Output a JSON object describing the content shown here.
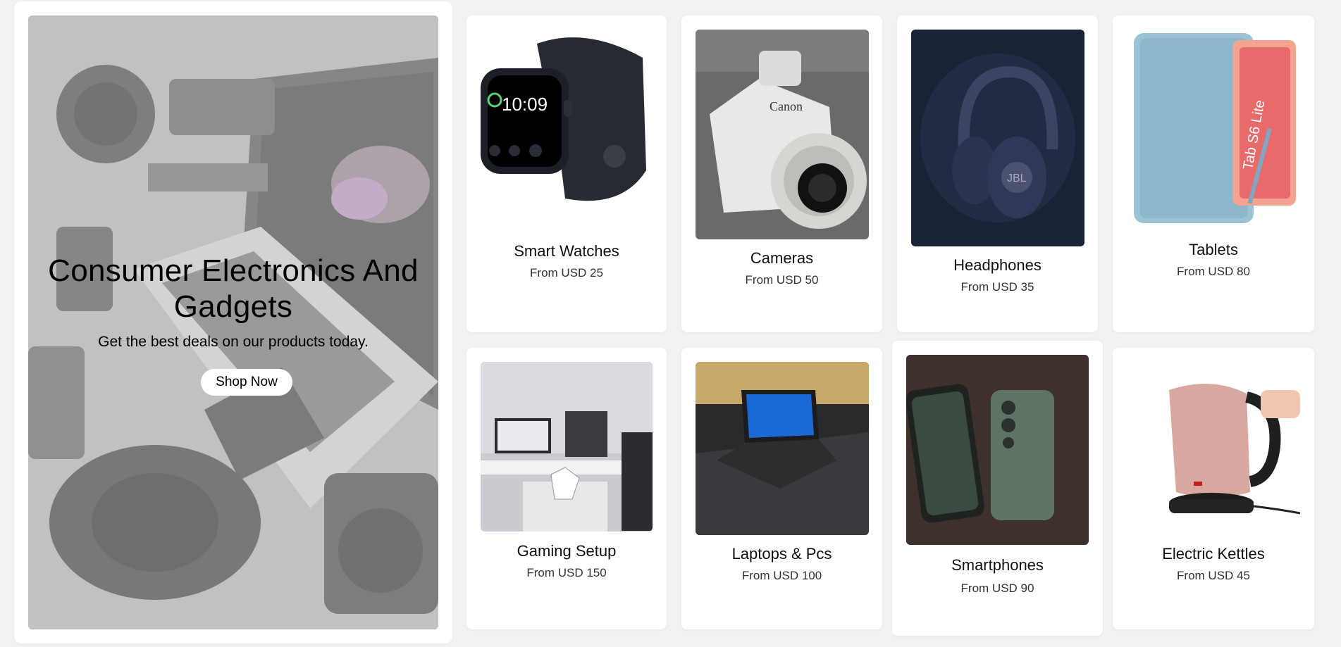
{
  "hero": {
    "title": "Consumer Electronics And Gadgets",
    "subtitle": "Get the best deals on our products today.",
    "button_label": "Shop Now"
  },
  "products": [
    {
      "name": "Smart Watches",
      "price": "From USD 25",
      "icon": "smartwatch-image"
    },
    {
      "name": "Cameras",
      "price": "From USD 50",
      "icon": "camera-image"
    },
    {
      "name": "Headphones",
      "price": "From USD 35",
      "icon": "headphones-image"
    },
    {
      "name": "Tablets",
      "price": "From USD 80",
      "icon": "tablet-image"
    },
    {
      "name": "Gaming Setup",
      "price": "From USD 150",
      "icon": "gaming-setup-image"
    },
    {
      "name": "Laptops & Pcs",
      "price": "From USD 100",
      "icon": "laptop-image"
    },
    {
      "name": "Smartphones",
      "price": "From USD 90",
      "icon": "smartphone-image"
    },
    {
      "name": "Electric Kettles",
      "price": "From USD 45",
      "icon": "kettle-image"
    }
  ],
  "colors": {
    "page_background": "#f1f2f4",
    "card_background": "#ffffff",
    "button_background": "#ffffff"
  }
}
